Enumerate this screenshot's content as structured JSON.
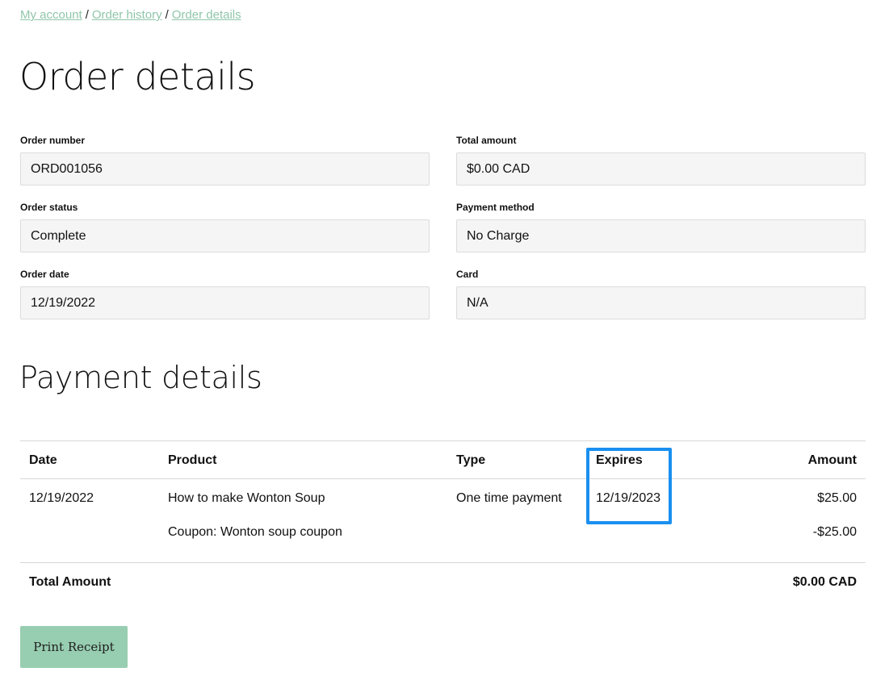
{
  "breadcrumb": {
    "items": [
      "My account",
      "Order history",
      "Order details"
    ],
    "separator": "/"
  },
  "page_title": "Order details",
  "fields": {
    "order_number": {
      "label": "Order number",
      "value": "ORD001056"
    },
    "total_amount": {
      "label": "Total amount",
      "value": "$0.00 CAD"
    },
    "order_status": {
      "label": "Order status",
      "value": "Complete"
    },
    "payment_method": {
      "label": "Payment method",
      "value": "No Charge"
    },
    "order_date": {
      "label": "Order date",
      "value": "12/19/2022"
    },
    "card": {
      "label": "Card",
      "value": "N/A"
    }
  },
  "payment_section_title": "Payment details",
  "table": {
    "headers": {
      "date": "Date",
      "product": "Product",
      "type": "Type",
      "expires": "Expires",
      "amount": "Amount"
    },
    "rows": [
      {
        "date": "12/19/2022",
        "product": "How to make Wonton Soup",
        "type": "One time payment",
        "expires": "12/19/2023",
        "amount": "$25.00"
      },
      {
        "date": "",
        "product": "Coupon: Wonton soup coupon",
        "type": "",
        "expires": "",
        "amount": "-$25.00"
      }
    ],
    "total_label": "Total Amount",
    "total_value": "$0.00 CAD"
  },
  "highlight_color": "#1a90f0",
  "accent_color": "#97cdb0",
  "print_button_label": "Print Receipt"
}
